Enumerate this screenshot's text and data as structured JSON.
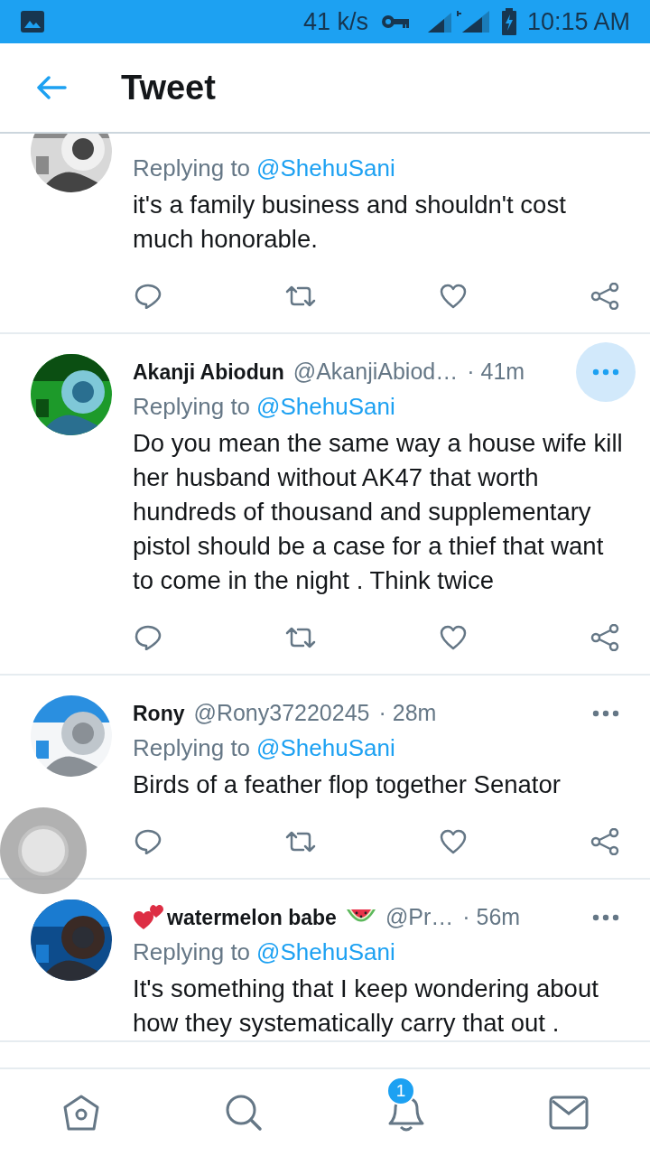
{
  "status_bar": {
    "speed": "41 k/s",
    "time": "10:15 AM"
  },
  "header": {
    "title": "Tweet"
  },
  "tweets": [
    {
      "replying_label": "Replying to",
      "replying_to": "@ShehuSani",
      "text": "it's a family business and shouldn't cost much honorable.",
      "actions": true
    },
    {
      "author": "Akanji Abiodun",
      "handle": "@AkanjiAbiod…",
      "time": "· 41m",
      "replying_label": "Replying to",
      "replying_to": "@ShehuSani",
      "text": "Do you mean the same way a house wife kill her husband without AK47 that worth hundreds of thousand and supplementary pistol should be a case for a thief that want to come in the night . Think twice",
      "menu_highlighted": true,
      "actions": true
    },
    {
      "author": "Rony",
      "handle": "@Rony37220245",
      "time": "· 28m",
      "replying_label": "Replying to",
      "replying_to": "@ShehuSani",
      "text": "Birds of a feather flop together Senator",
      "menu_highlighted": false,
      "actions": true
    },
    {
      "author": "watermelon babe",
      "author_emoji": true,
      "handle": "@Pr…",
      "time": "· 56m",
      "replying_label": "Replying to",
      "replying_to": "@ShehuSani",
      "text": "It's something that I keep wondering about how they systematically carry that out .",
      "menu_highlighted": false
    }
  ],
  "bottom_nav": {
    "notification_badge": "1"
  }
}
